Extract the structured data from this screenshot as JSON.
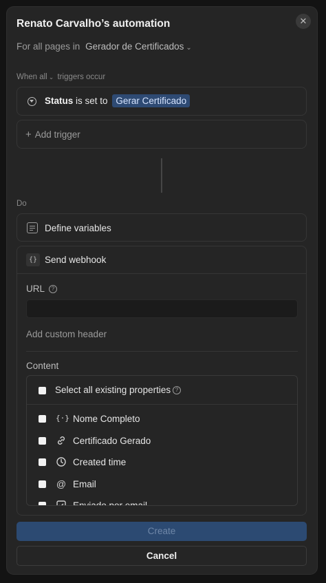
{
  "modal": {
    "title": "Renato Carvalho’s automation",
    "scope_prefix": "For all pages in",
    "database": "Gerador de Certificados"
  },
  "trigger": {
    "when_label": "When all",
    "when_suffix": "triggers occur",
    "property": "Status",
    "condition": "is set to",
    "value": "Gerar Certificado",
    "add_trigger": "Add trigger"
  },
  "actions": {
    "do_label": "Do",
    "define_variables": "Define variables",
    "webhook": {
      "title": "Send webhook",
      "url_label": "URL",
      "url_value": "",
      "add_header": "Add custom header",
      "content_label": "Content",
      "select_all": "Select all existing properties",
      "properties": [
        {
          "label": "Nome Completo",
          "icon": "text-braces-icon"
        },
        {
          "label": "Certificado Gerado",
          "icon": "link-icon"
        },
        {
          "label": "Created time",
          "icon": "clock-icon"
        },
        {
          "label": "Email",
          "icon": "at-icon"
        },
        {
          "label": "Enviado por email",
          "icon": "checkbox-icon"
        }
      ]
    }
  },
  "footer": {
    "create": "Create",
    "cancel": "Cancel"
  }
}
